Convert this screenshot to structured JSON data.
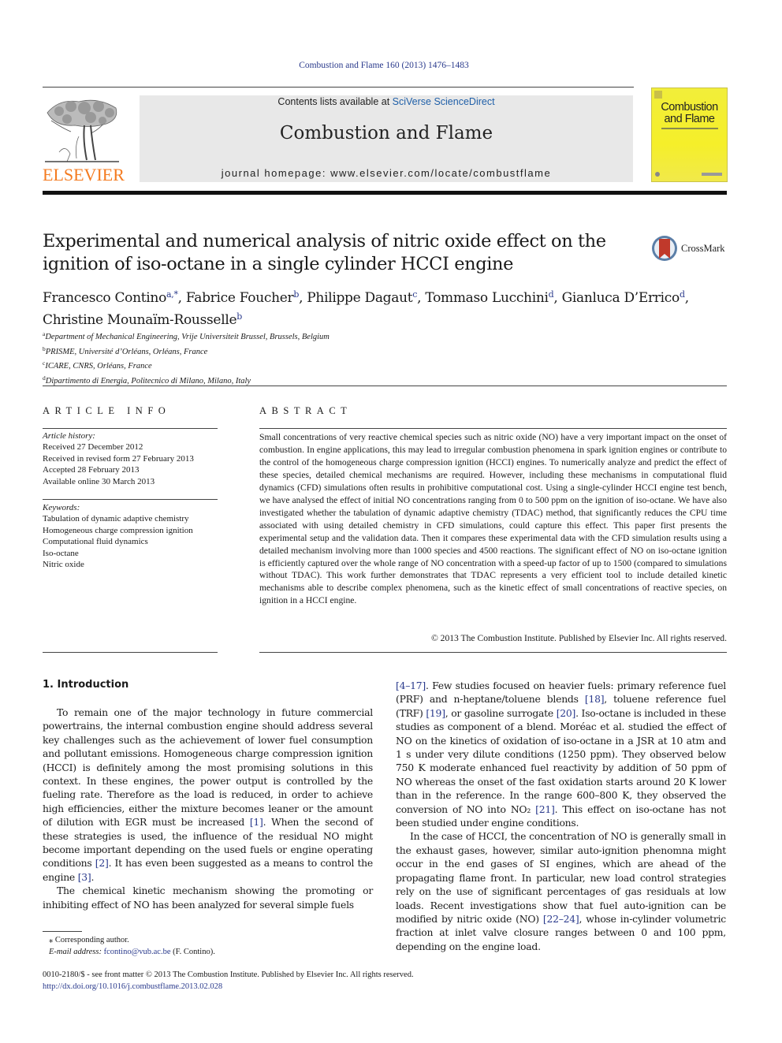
{
  "header": {
    "journal_ref": "Combustion and Flame 160 (2013) 1476–1483",
    "contents_prefix": "Contents lists available at ",
    "contents_link": "SciVerse ScienceDirect",
    "journal_name": "Combustion and Flame",
    "homepage": "journal homepage: www.elsevier.com/locate/combustflame",
    "publisher_logo": "ELSEVIER",
    "cover_title_line1": "Combustion",
    "cover_title_line2": "and Flame",
    "brand_orange": "#f47b20",
    "cover_yellow": "#f3ee35"
  },
  "article": {
    "title": "Experimental and numerical analysis of nitric oxide effect on the ignition of iso-octane in a single cylinder HCCI engine",
    "crossmark_label": "CrossMark",
    "authors": [
      {
        "name": "Francesco Contino",
        "aff": "a,*",
        "sep": ", "
      },
      {
        "name": "Fabrice Foucher",
        "aff": "b",
        "sep": ", "
      },
      {
        "name": "Philippe Dagaut",
        "aff": "c",
        "sep": ", "
      },
      {
        "name": "Tommaso Lucchini",
        "aff": "d",
        "sep": ", "
      },
      {
        "name": "Gianluca D’Errico",
        "aff": "d",
        "sep": ","
      },
      {
        "name": "Christine Mounaïm-Rousselle",
        "aff": "b",
        "sep": ""
      }
    ],
    "affiliations": [
      {
        "key": "a",
        "text": "Department of Mechanical Engineering, Vrije Universiteit Brussel, Brussels, Belgium"
      },
      {
        "key": "b",
        "text": "PRISME, Université d’Orléans, Orléans, France"
      },
      {
        "key": "c",
        "text": "ICARE, CNRS, Orléans, France"
      },
      {
        "key": "d",
        "text": "Dipartimento di Energia, Politecnico di Milano, Milano, Italy"
      }
    ]
  },
  "article_info": {
    "heading": "ARTICLE INFO",
    "history_label": "Article history:",
    "history": [
      "Received 27 December 2012",
      "Received in revised form 27 February 2013",
      "Accepted 28 February 2013",
      "Available online 30 March 2013"
    ],
    "keywords_label": "Keywords:",
    "keywords": [
      "Tabulation of dynamic adaptive chemistry",
      "Homogeneous charge compression ignition",
      "Computational fluid dynamics",
      "Iso-octane",
      "Nitric oxide"
    ]
  },
  "abstract": {
    "heading": "ABSTRACT",
    "text": "Small concentrations of very reactive chemical species such as nitric oxide (NO) have a very important impact on the onset of combustion. In engine applications, this may lead to irregular combustion phenomena in spark ignition engines or contribute to the control of the homogeneous charge compression ignition (HCCI) engines. To numerically analyze and predict the effect of these species, detailed chemical mechanisms are required. However, including these mechanisms in computational fluid dynamics (CFD) simulations often results in prohibitive computational cost. Using a single-cylinder HCCI engine test bench, we have analysed the effect of initial NO concentrations ranging from 0 to 500 ppm on the ignition of iso-octane. We have also investigated whether the tabulation of dynamic adaptive chemistry (TDAC) method, that significantly reduces the CPU time associated with using detailed chemistry in CFD simulations, could capture this effect. This paper first presents the experimental setup and the validation data. Then it compares these experimental data with the CFD simulation results using a detailed mechanism involving more than 1000 species and 4500 reactions. The significant effect of NO on iso-octane ignition is efficiently captured over the whole range of NO concentration with a speed-up factor of up to 1500 (compared to simulations without TDAC). This work further demonstrates that TDAC represents a very efficient tool to include detailed kinetic mechanisms able to describe complex phenomena, such as the kinetic effect of small concentrations of reactive species, on ignition in a HCCI engine.",
    "copyright": "© 2013 The Combustion Institute. Published by Elsevier Inc. All rights reserved."
  },
  "body": {
    "section_heading": "1. Introduction",
    "left_paragraphs": [
      [
        {
          "t": "To remain one of the major technology in future commercial powertrains, the internal combustion engine should address several key challenges such as the achievement of lower fuel consumption and pollutant emissions. Homogeneous charge compression ignition (HCCI) is definitely among the most promising solutions in this context. In these engines, the power output is controlled by the fueling rate. Therefore as the load is reduced, in order to achieve high efficiencies, either the mixture becomes leaner or the amount of dilution with EGR must be increased "
        },
        {
          "ref": "[1]"
        },
        {
          "t": ". When the second of these strategies is used, the influence of the residual NO might become important depending on the used fuels or engine operating conditions "
        },
        {
          "ref": "[2]"
        },
        {
          "t": ". It has even been suggested as a means to control the engine "
        },
        {
          "ref": "[3]"
        },
        {
          "t": "."
        }
      ],
      [
        {
          "t": "The chemical kinetic mechanism showing the promoting or inhibiting effect of NO has been analyzed for several simple fuels"
        }
      ]
    ],
    "right_paragraphs": [
      [
        {
          "ref": "[4–17]"
        },
        {
          "t": ". Few studies focused on heavier fuels: primary reference fuel (PRF) and n-heptane/toluene blends "
        },
        {
          "ref": "[18]"
        },
        {
          "t": ", toluene reference fuel (TRF) "
        },
        {
          "ref": "[19]"
        },
        {
          "t": ", or gasoline surrogate "
        },
        {
          "ref": "[20]"
        },
        {
          "t": ". Iso-octane is included in these studies as component of a blend. Moréac et al. studied the effect of NO on the kinetics of oxidation of iso-octane in a JSR at 10 atm and 1 s under very dilute conditions (1250 ppm). They observed below 750 K moderate enhanced fuel reactivity by addition of 50 ppm of NO whereas the onset of the fast oxidation starts around 20 K lower than in the reference. In the range 600–800 K, they observed the conversion of NO into NO₂ "
        },
        {
          "ref": "[21]"
        },
        {
          "t": ". This effect on iso-octane has not been studied under engine conditions."
        }
      ],
      [
        {
          "t": "In the case of HCCI, the concentration of NO is generally small in the exhaust gases, however, similar auto-ignition phenomna might occur in the end gases of SI engines, which are ahead of the propagating flame front. In particular, new load control strategies rely on the use of significant percentages of gas residuals at low loads. Recent investigations show that fuel auto-ignition can be modified by nitric oxide (NO) "
        },
        {
          "ref": "[22–24]"
        },
        {
          "t": ", whose in-cylinder volumetric fraction at inlet valve closure ranges between 0 and 100 ppm, depending on the engine load."
        }
      ]
    ]
  },
  "footnotes": {
    "corresponding": "⁎ Corresponding author.",
    "email_label": "E-mail address:",
    "email": "fcontino@vub.ac.be",
    "email_suffix": " (F. Contino)."
  },
  "footer": {
    "issn_line": "0010-2180/$ - see front matter © 2013 The Combustion Institute. Published by Elsevier Inc. All rights reserved.",
    "doi": "http://dx.doi.org/10.1016/j.combustflame.2013.02.028"
  }
}
